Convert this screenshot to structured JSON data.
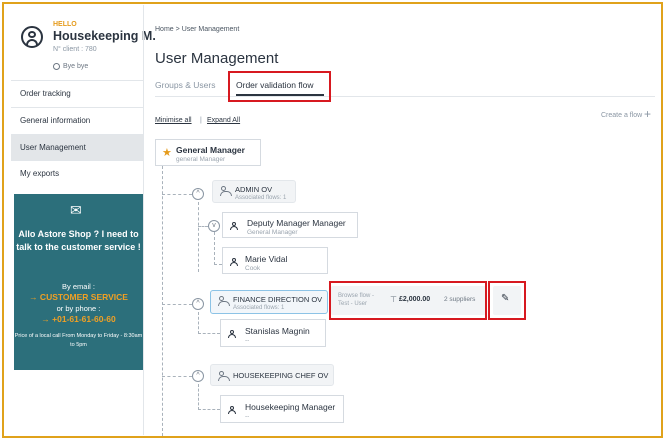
{
  "account": {
    "greeting": "HELLO",
    "name": "Housekeeping M.",
    "client": "N° client : 780",
    "logout": "Bye bye"
  },
  "sidebar": {
    "items": [
      {
        "label": "Order tracking"
      },
      {
        "label": "General information"
      },
      {
        "label": "User Management"
      },
      {
        "label": "My exports"
      }
    ]
  },
  "promo": {
    "question": "Allo Astore Shop ? I need to talk to the customer service !",
    "by_email": "By email :",
    "email_link": "→  CUSTOMER SERVICE",
    "by_phone": "or by phone :",
    "phone": "→  +01-61-61-60-60",
    "price_note": "Price of a local call From Monday to Friday - 8:30am to 5pm"
  },
  "breadcrumb": {
    "home": "Home",
    "sep": ">",
    "current": "User Management"
  },
  "page_title": "User Management",
  "tabs": [
    {
      "label": "Groups & Users"
    },
    {
      "label": "Order validation flow"
    }
  ],
  "controls": {
    "minimise": "Minimise all",
    "sep": "|",
    "expand": "Expand All",
    "create_flow": "Create a flow",
    "plus": "+"
  },
  "tree": {
    "root": {
      "name": "General Manager",
      "sub": "general Manager"
    },
    "admin": {
      "name": "ADMIN OV",
      "sub": "Associated flows: 1",
      "toggle": "^"
    },
    "deputy": {
      "name": "Deputy Manager Manager",
      "sub": "General Manager",
      "toggle": "v"
    },
    "marie": {
      "name": "Marie Vidal",
      "sub": "Cook"
    },
    "finance": {
      "name": "FINANCE DIRECTION OV",
      "sub": "Associated flows: 1",
      "toggle": "^"
    },
    "stanislas": {
      "name": "Stanislas Magnin",
      "sub": "--"
    },
    "hkchef": {
      "name": "HOUSEKEEPING CHEF OV",
      "toggle": "^"
    },
    "hkmanager": {
      "name": "Housekeeping Manager",
      "sub": "--"
    }
  },
  "flow": {
    "line1": "Browse flow -",
    "line2": "Test - User",
    "amount": "£2,000.00",
    "suppliers": "2 suppliers"
  },
  "colors": {
    "accent": "#e59b1c",
    "promo_bg": "#2c6f7b",
    "highlight": "#d71920",
    "selected_border": "#8cc3e6"
  }
}
